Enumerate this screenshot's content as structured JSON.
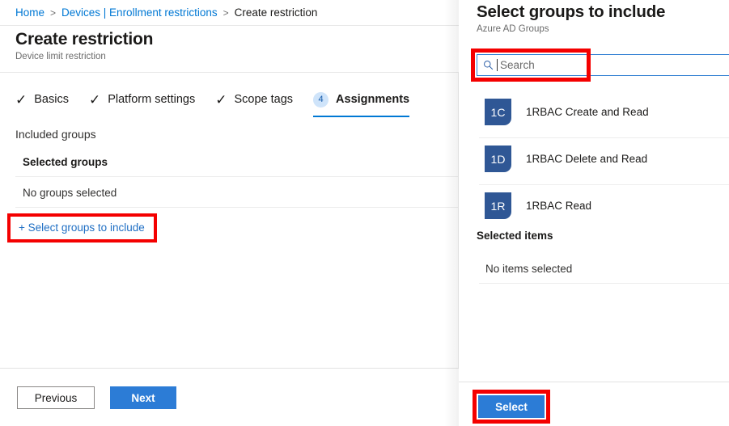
{
  "breadcrumb": {
    "items": [
      {
        "label": "Home",
        "type": "link"
      },
      {
        "label": "Devices | Enrollment restrictions",
        "type": "link"
      },
      {
        "label": "Create restriction",
        "type": "current"
      }
    ],
    "separator": ">"
  },
  "blade": {
    "title": "Create restriction",
    "subtitle": "Device limit restriction",
    "tabs": [
      {
        "label": "Basics",
        "state": "complete",
        "marker": "✓"
      },
      {
        "label": "Platform settings",
        "state": "complete",
        "marker": "✓"
      },
      {
        "label": "Scope tags",
        "state": "complete",
        "marker": "✓"
      },
      {
        "label": "Assignments",
        "state": "active",
        "marker": "4"
      }
    ],
    "included_groups_label": "Included groups",
    "selected_groups_header": "Selected groups",
    "no_groups_selected": "No groups selected",
    "select_groups_link": "+ Select groups to include",
    "footer": {
      "previous_label": "Previous",
      "next_label": "Next"
    }
  },
  "panel": {
    "title": "Select groups to include",
    "subtitle": "Azure AD Groups",
    "search": {
      "placeholder": "Search",
      "value": "",
      "icon": "search-icon"
    },
    "groups": [
      {
        "initials": "1C",
        "name": "1RBAC Create and Read"
      },
      {
        "initials": "1D",
        "name": "1RBAC Delete and Read"
      },
      {
        "initials": "1R",
        "name": "1RBAC Read"
      }
    ],
    "selected_items_header": "Selected items",
    "no_items_selected": "No items selected",
    "select_button_label": "Select"
  },
  "colors": {
    "accent_blue": "#2c7cd6",
    "link_blue": "#0078d4",
    "highlight_red": "#f40000",
    "avatar_blue": "#2f5795",
    "badge_bg": "#cfe4fa",
    "badge_text": "#1258a8"
  }
}
